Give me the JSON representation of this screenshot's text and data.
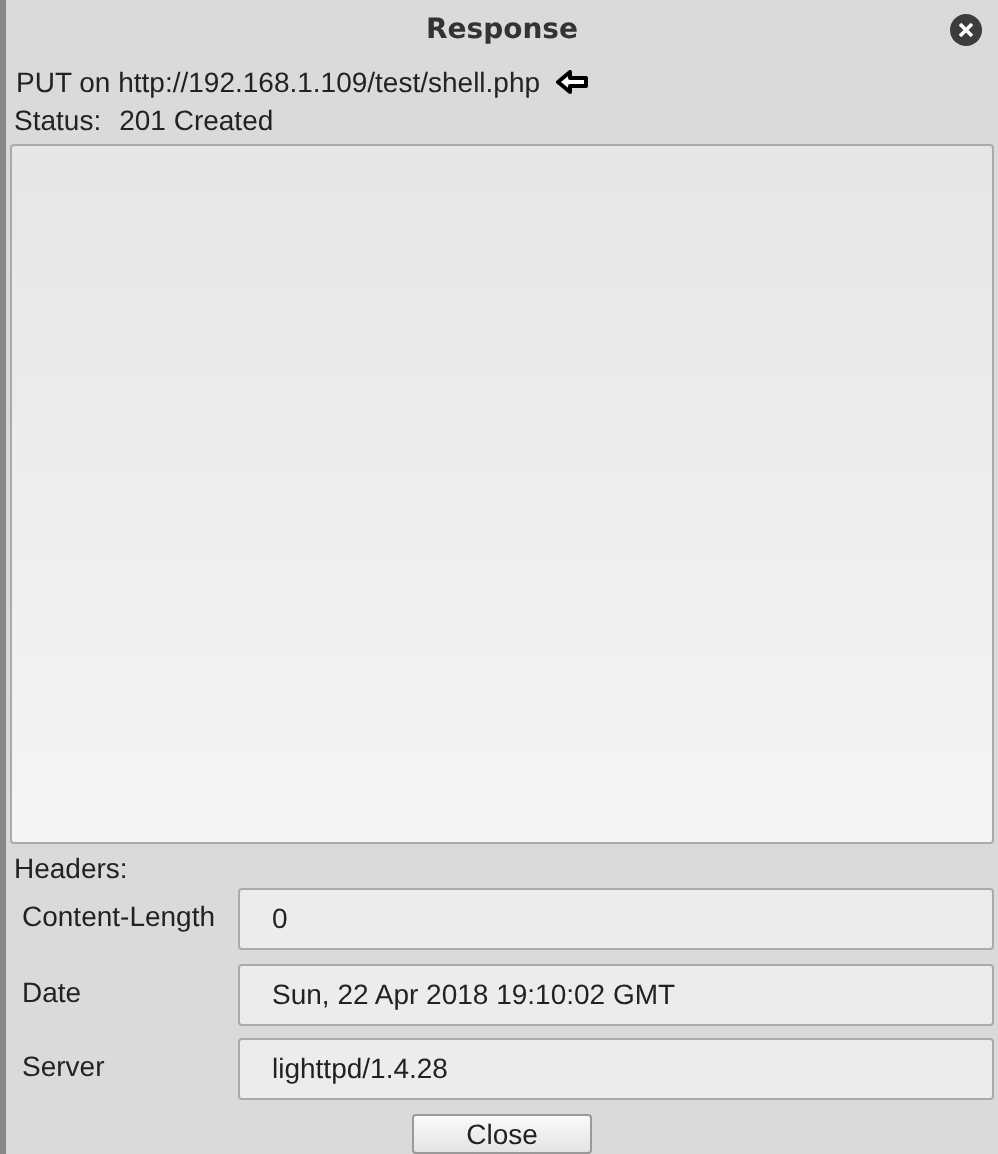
{
  "window": {
    "title": "Response"
  },
  "request": {
    "line": "PUT on http://192.168.1.109/test/shell.php"
  },
  "status": {
    "label": "Status:",
    "value": "201 Created"
  },
  "headers_label": "Headers:",
  "headers": [
    {
      "name": "Content-Length",
      "value": "0"
    },
    {
      "name": "Date",
      "value": "Sun, 22 Apr 2018 19:10:02 GMT"
    },
    {
      "name": "Server",
      "value": "lighttpd/1.4.28"
    }
  ],
  "buttons": [
    "Close"
  ]
}
